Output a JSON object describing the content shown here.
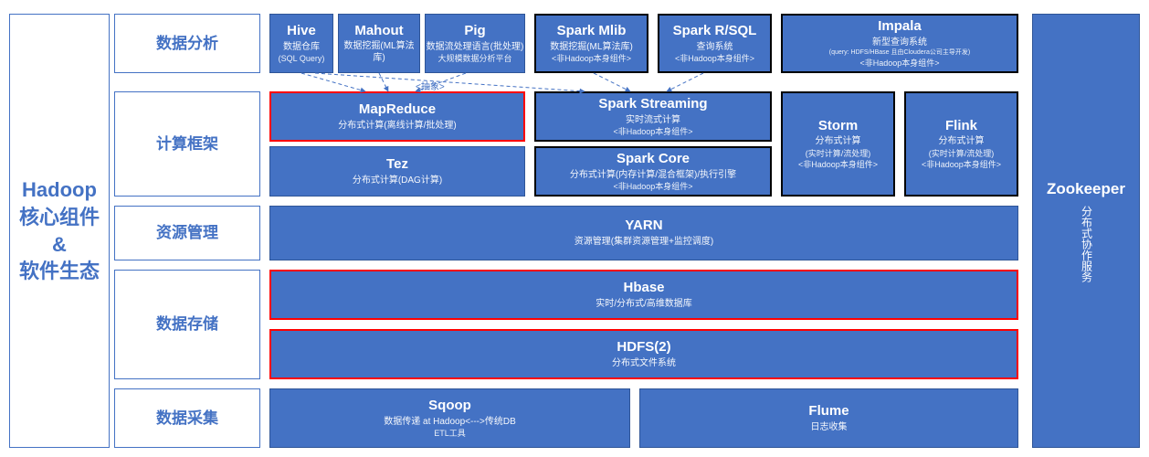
{
  "left_panel": {
    "line1": "Hadoop",
    "line2": "核心组件",
    "line3": "&",
    "line4": "软件生态"
  },
  "categories": {
    "analysis": "数据分析",
    "compute": "计算框架",
    "resource": "资源管理",
    "storage": "数据存储",
    "ingest": "数据采集"
  },
  "blocks": {
    "hive": {
      "title": "Hive",
      "sub": "数据仓库",
      "sub2": "(SQL Query)"
    },
    "mahout": {
      "title": "Mahout",
      "sub": "数据挖掘(ML算法库)"
    },
    "pig": {
      "title": "Pig",
      "sub": "数据流处理语言(批处理)",
      "sub2": "大规模数据分析平台"
    },
    "sparkmlib": {
      "title": "Spark Mlib",
      "sub": "数据挖掘(ML算法库)",
      "sub2": "<非Hadoop本身组件>"
    },
    "sparkrsql": {
      "title": "Spark R/SQL",
      "sub": "查询系统",
      "sub2": "<非Hadoop本身组件>"
    },
    "impala": {
      "title": "Impala",
      "sub": "新型查询系统",
      "sub2": "(query: HDFS/HBase 且由Cloudera公司主导开发)",
      "sub3": "<非Hadoop本身组件>"
    },
    "mapreduce": {
      "title": "MapReduce",
      "sub": "分布式计算(离线计算/批处理)"
    },
    "tez": {
      "title": "Tez",
      "sub": "分布式计算(DAG计算)"
    },
    "sparkstreaming": {
      "title": "Spark Streaming",
      "sub": "实时流式计算",
      "sub2": "<非Hadoop本身组件>"
    },
    "sparkcore": {
      "title": "Spark Core",
      "sub": "分布式计算(内存计算/混合框架)/执行引擎",
      "sub2": "<非Hadoop本身组件>"
    },
    "storm": {
      "title": "Storm",
      "sub": "分布式计算",
      "sub2": "(实时计算/流处理)",
      "sub3": "<非Hadoop本身组件>"
    },
    "flink": {
      "title": "Flink",
      "sub": "分布式计算",
      "sub2": "(实时计算/流处理)",
      "sub3": "<非Hadoop本身组件>"
    },
    "yarn": {
      "title": "YARN",
      "sub": "资源管理(集群资源管理+监控调度)"
    },
    "hbase": {
      "title": "Hbase",
      "sub": "实时/分布式/高维数据库"
    },
    "hdfs": {
      "title": "HDFS(2)",
      "sub": "分布式文件系统"
    },
    "sqoop": {
      "title": "Sqoop",
      "sub": "数据传递 at Hadoop<--->传统DB",
      "sub2": "ETL工具"
    },
    "flume": {
      "title": "Flume",
      "sub": "日志收集"
    }
  },
  "zookeeper": {
    "title": "Zookeeper",
    "sub": "分布式协作服务"
  },
  "abstract_label": "<抽象>"
}
